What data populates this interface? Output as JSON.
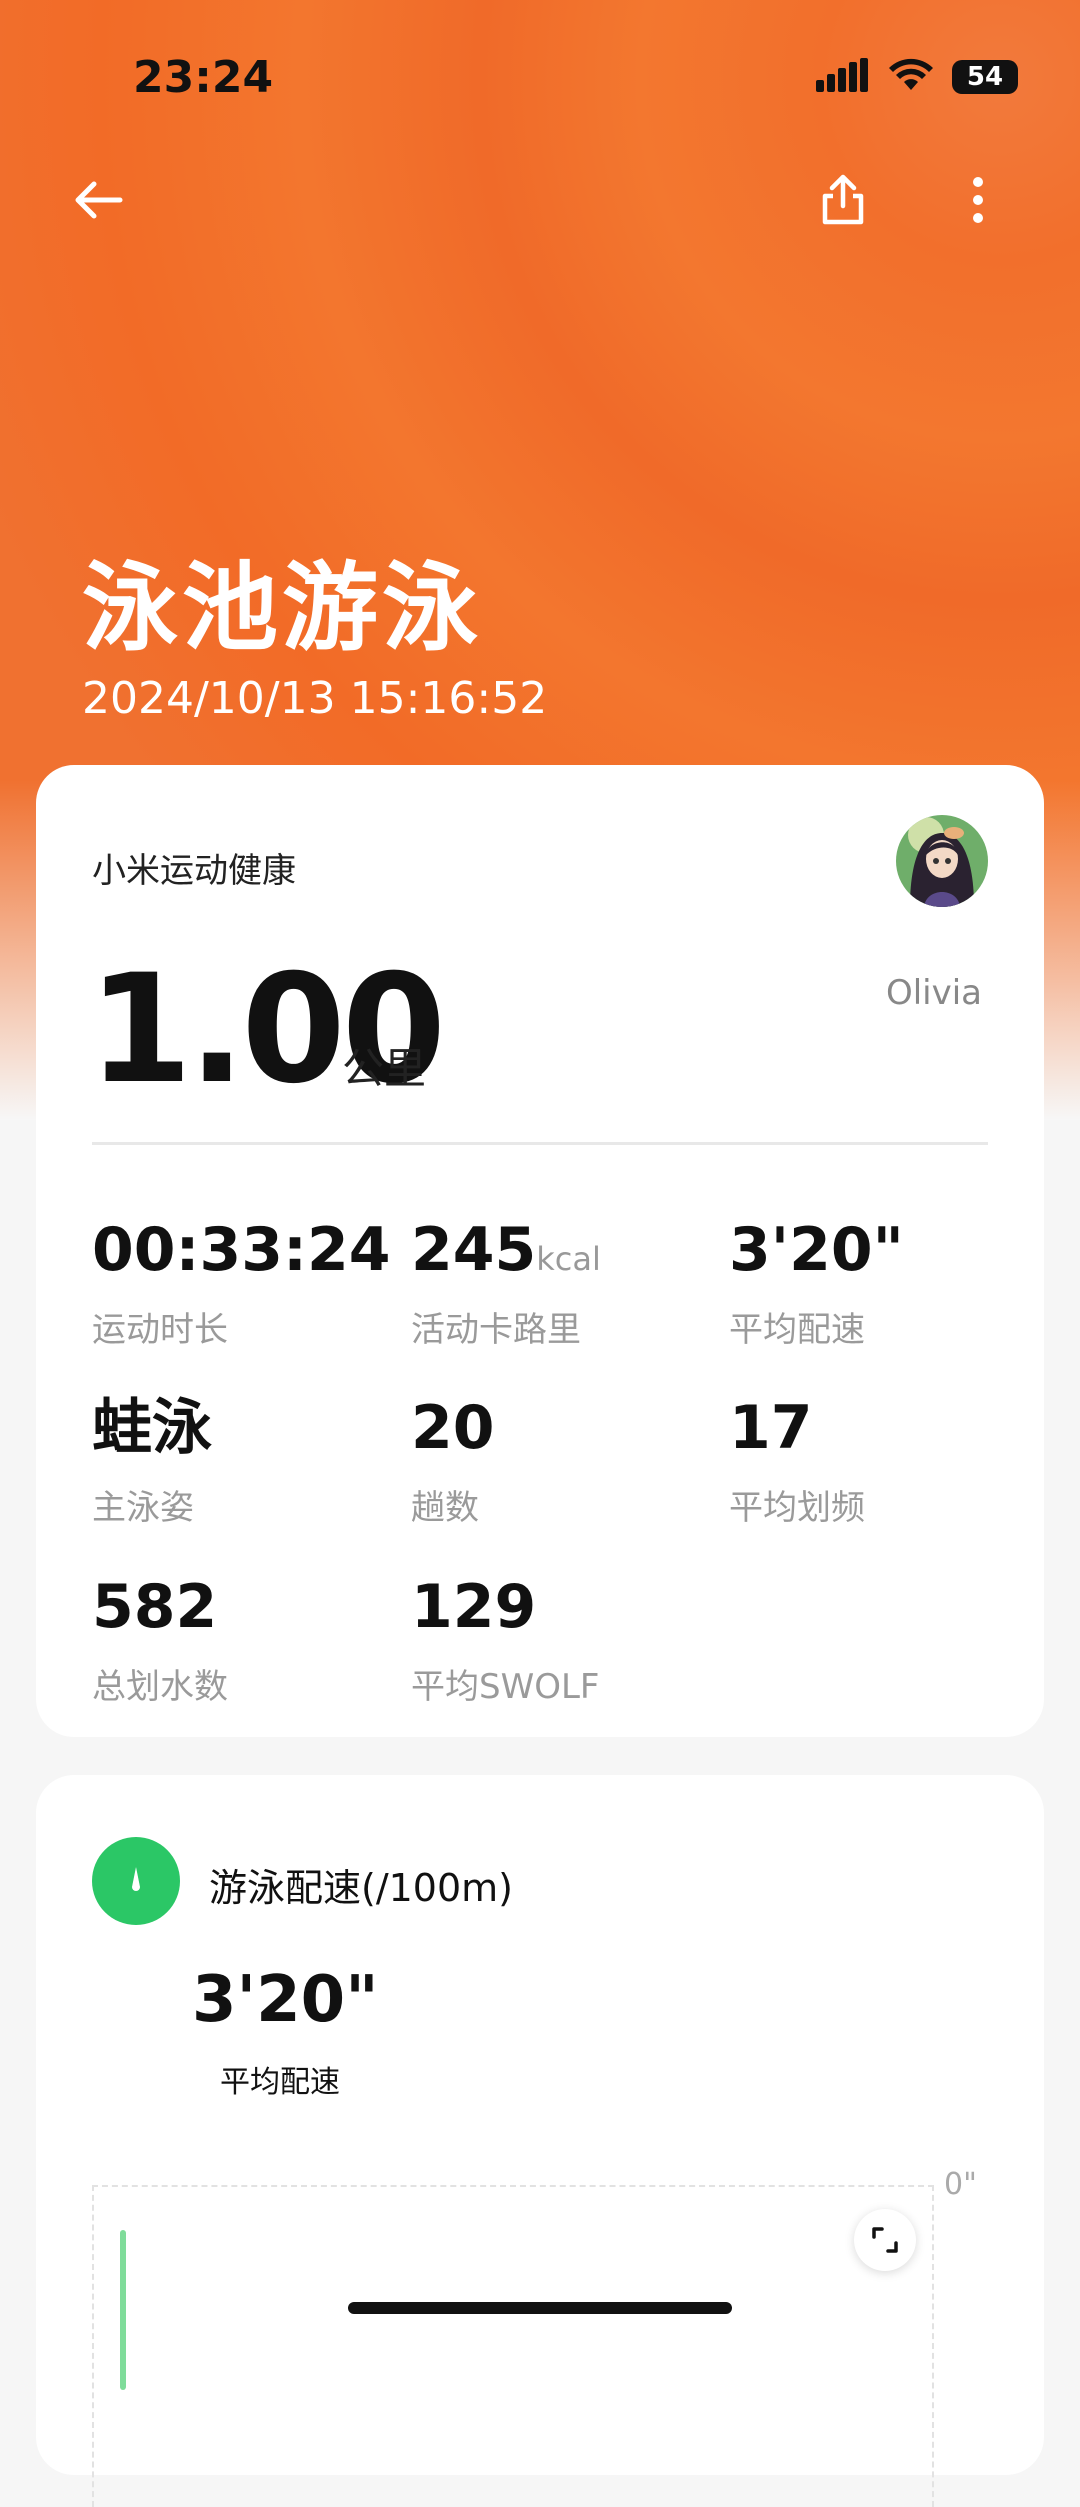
{
  "status_bar": {
    "time": "23:24",
    "battery": "54"
  },
  "header": {
    "title": "泳池游泳",
    "datetime": "2024/10/13 15:16:52"
  },
  "summary": {
    "brand": "小米运动健康",
    "username": "Olivia",
    "distance": "1.00",
    "distance_unit": "公里",
    "stats": [
      {
        "value": "00:33:24",
        "unit": "",
        "label": "运动时长"
      },
      {
        "value": "245",
        "unit": "kcal",
        "label": "活动卡路里"
      },
      {
        "value": "3'20\"",
        "unit": "",
        "label": "平均配速"
      },
      {
        "value": "蛙泳",
        "unit": "",
        "label": "主泳姿"
      },
      {
        "value": "20",
        "unit": "",
        "label": "趟数"
      },
      {
        "value": "17",
        "unit": "",
        "label": "平均划频"
      },
      {
        "value": "582",
        "unit": "",
        "label": "总划水数"
      },
      {
        "value": "129",
        "unit": "",
        "label": "平均SWOLF"
      }
    ]
  },
  "pace_card": {
    "title": "游泳配速(/100m)",
    "value": "3'20\"",
    "label": "平均配速",
    "axis_max": "0\""
  },
  "colors": {
    "hero": "#f26f2c",
    "pace_icon": "#2bc766",
    "chart_line": "#7fdc9a"
  }
}
